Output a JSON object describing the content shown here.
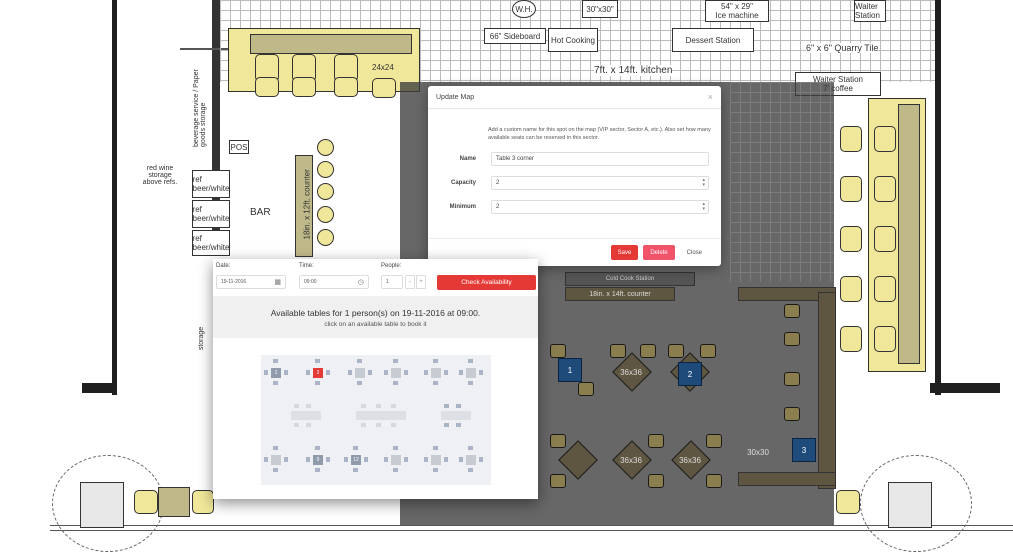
{
  "floor_plan": {
    "labels": {
      "sideboard": "66\" Sideboard",
      "hot_cooking": "Hot Cooking",
      "dessert_station": "Dessert Station",
      "quarry_tile": "6\" x 6\" Quarry Tile",
      "waiter_station_top": "Waiter Station",
      "waiter_station": "Waiter Station",
      "coffee": "7' coffee",
      "kitchen": "7ft. x 14ft. kitchen",
      "bar": "BAR",
      "bar_counter": "18in. x 12ft. counter",
      "pos": "POS",
      "size_24": "24x24",
      "storage_note": "beverage service / Paper goods storage",
      "red_wine": "red wine storage above refs.",
      "ref1": "ref beer/white",
      "ref2": "ref beer/white",
      "ref3": "ref beer/white",
      "storage": "storage",
      "ice_machine": "Ice machine",
      "ice_size": "54\" x 29\"",
      "size_30": "30\"x30\"",
      "wh": "W.H.",
      "counter_bottom": "18in. x 14ft. counter",
      "cold_cook": "Cold Cook Station",
      "table_36a": "36x36",
      "table_36b": "36x36",
      "table_36c": "36x36",
      "table_36d": "36x36",
      "table_30": "30x30",
      "blue_1": "1",
      "blue_2": "2",
      "blue_3": "3"
    }
  },
  "update_modal": {
    "title": "Update Map",
    "close_icon": "×",
    "description": "Add a custom name for this spot on the map (VIP sector, Sector A, etc.). Also set how many available seats can be reserved in this sector.",
    "name_label": "Name",
    "name_value": "Table 3 corner",
    "capacity_label": "Capacity",
    "capacity_value": "2",
    "minimum_label": "Minimum",
    "minimum_value": "2",
    "save_label": "Save",
    "delete_label": "Delete",
    "close_label": "Close"
  },
  "availability": {
    "date_label": "Date:",
    "date_value": "19-11-2016",
    "time_label": "Time:",
    "time_value": "09:00",
    "people_label": "People:",
    "people_value": "1",
    "minus": "-",
    "plus": "+",
    "check_label": "Check Availability",
    "title": "Available tables for 1 person(s) on 19-11-2016 at 09:00.",
    "subtitle": "click on an available table to book it",
    "table_numbers": {
      "t1": "1",
      "t2": "2",
      "t9": "9",
      "t12": "12"
    }
  }
}
